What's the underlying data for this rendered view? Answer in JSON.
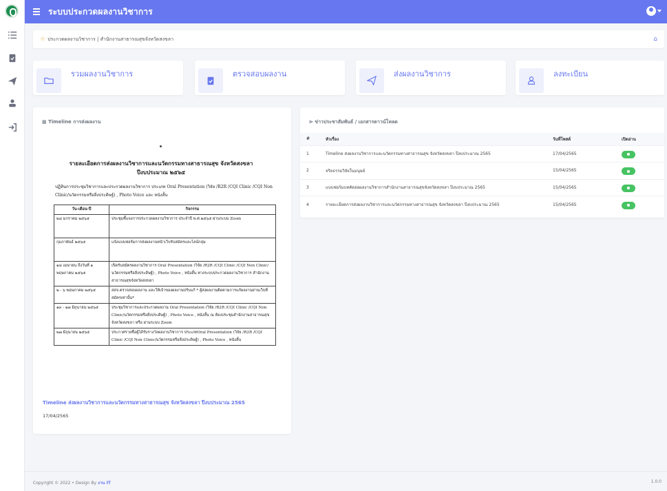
{
  "app": {
    "title": "ระบบประกวดผลงานวิชาการ"
  },
  "breadcrumb": {
    "text": "ประกวดผลงานวิชาการ | สำนักงานสาธารณสุขจังหวัดสงขลา"
  },
  "quick_actions": [
    {
      "label": "รวมผลงานวิชาการ",
      "icon": "folder-icon"
    },
    {
      "label": "ตรวจสอบผลงาน",
      "icon": "clipboard-check-icon"
    },
    {
      "label": "ส่งผลงานวิชาการ",
      "icon": "send-icon"
    },
    {
      "label": "ลงทะเบียน",
      "icon": "user-icon"
    }
  ],
  "timeline": {
    "header": "Timeline การส่งผลงาน",
    "doc_title_1": "รายละเอียดการส่งผลงานวิชาการและนวัตกรรมทางสาธารณสุข จังหวัดสงขลา",
    "doc_title_2": "ปีงบประมาณ ๒๕๖๕",
    "doc_intro": "ปฏิทินการประชุมวิชาการและประกวดผลงานวิชาการ ประเภท Oral Presentation (วิจัย /R2R /CQI Clinic /CQI Non Clinic/นวัตกรรมหรือสิ่งประดิษฐ์) , Photo Voice และ หนังสั้น",
    "table_headers": [
      "วัน-เดือน-ปี",
      "กิจกรรม"
    ],
    "rows": [
      {
        "date": "๒๘ มกราคม ๒๕๖๕",
        "activity": "ประชุมชี้แจงการประกวดผลงานวิชาการ ประจำปี พ.ศ.๒๕๖๕ ผ่านระบบ Zoom"
      },
      {
        "date": "กุมภาพันธ์ ๒๕๖๕",
        "activity": "แจ้งแบบฟอร์มการส่งผลงานหน้าเว็บรับสมัครและไลน์กลุ่ม"
      },
      {
        "date": "๑๘ เมษายน ถึงวันที่ ๑ พฤษภาคม ๒๕๖๕",
        "activity": "เปิดรับสมัครผลงานวิชาการ Oral Presentation (วิจัย /R2R /CQI Clinic /CQI Non Clinic/นวัตกรรมหรือสิ่งประดิษฐ์) , Photo Voice , หนังสั้น ทางระบบประกวดผลงานวิชาการ สำนักงานสาธารณสุขจังหวัดสงขลา"
      },
      {
        "date": "๒ - ๖ พฤษภาคม ๒๕๖๕",
        "activity": "สสจ.ตรวจสอบผลงาน และให้เจ้าของผลงานปรับแก้ * ผู้ส่งผลงานติดตามการแก้ผลงานผ่านเว็บที่สมัครเท่านั้น*"
      },
      {
        "date": "๑๓ - ๑๗ มิถุนายน ๒๕๖๕",
        "activity": "ประชุมวิชาการและประกวดผลงาน Oral Presentation (วิจัย /R2R /CQI Clinic /CQI Non Clinic/นวัตกรรมหรือสิ่งประดิษฐ์) , Photo Voice , หนังสั้น ณ ห้องประชุมสำนักงานสาธารณสุขจังหวัดสงขลา หรือ ผ่านระบบ Zoom"
      },
      {
        "date": "๒๗ มิถุนายน ๒๕๖๕",
        "activity": "ประกาศรายชื่อผู้ได้รับรางวัลผลงานวิชาการ ประเภทOral Presentation (วิจัย /R2R /CQI Clinic /CQI Non Clinic/นวัตกรรมหรือสิ่งประดิษฐ์) , Photo Voice , หนังสั้น"
      }
    ],
    "link": "Timeline ส่งผลงานวิชาการและนวัตกรรมทางสาธารณสุข จังหวัดสงขลา ปีงบประมาณ 2565",
    "date": "17/04/2565"
  },
  "news": {
    "header": "ข่าวประชาสัมพันธ์ / เอกสารดาวน์โหลด",
    "columns": [
      "#",
      "หัวเรื่อง",
      "วันที่โพสต์",
      "เปิดอ่าน"
    ],
    "rows": [
      {
        "no": "1",
        "title": "Timeline ส่งผลงานวิชาการและนวัตกรรมทางสาธารณสุข จังหวัดสงขลา ปีงบประมาณ 2565",
        "date": "17/04/2565"
      },
      {
        "no": "2",
        "title": "จริยธรรมวิจัยในมนุษย์",
        "date": "15/04/2565"
      },
      {
        "no": "3",
        "title": "แบบฟอร์มบทคัดย่อผลงานวิชาการสำนักงานสาธารณสุขจังหวัดสงขลา ปีงบประมาณ 2565",
        "date": "15/04/2565"
      },
      {
        "no": "4",
        "title": "รายละเอียดการส่งผลงานวิชาการและนวัตกรรมทางสาธารณสุข จังหวัดสงขลา ปีงบประมาณ 2565",
        "date": "15/04/2565"
      }
    ]
  },
  "footer": {
    "copyright": "Copyright © 2022 • Design By",
    "brand": "งาน IT",
    "version": "1.0.0"
  },
  "colors": {
    "primary": "#6777ef",
    "success": "#47c363",
    "background": "#f4f5f8"
  }
}
